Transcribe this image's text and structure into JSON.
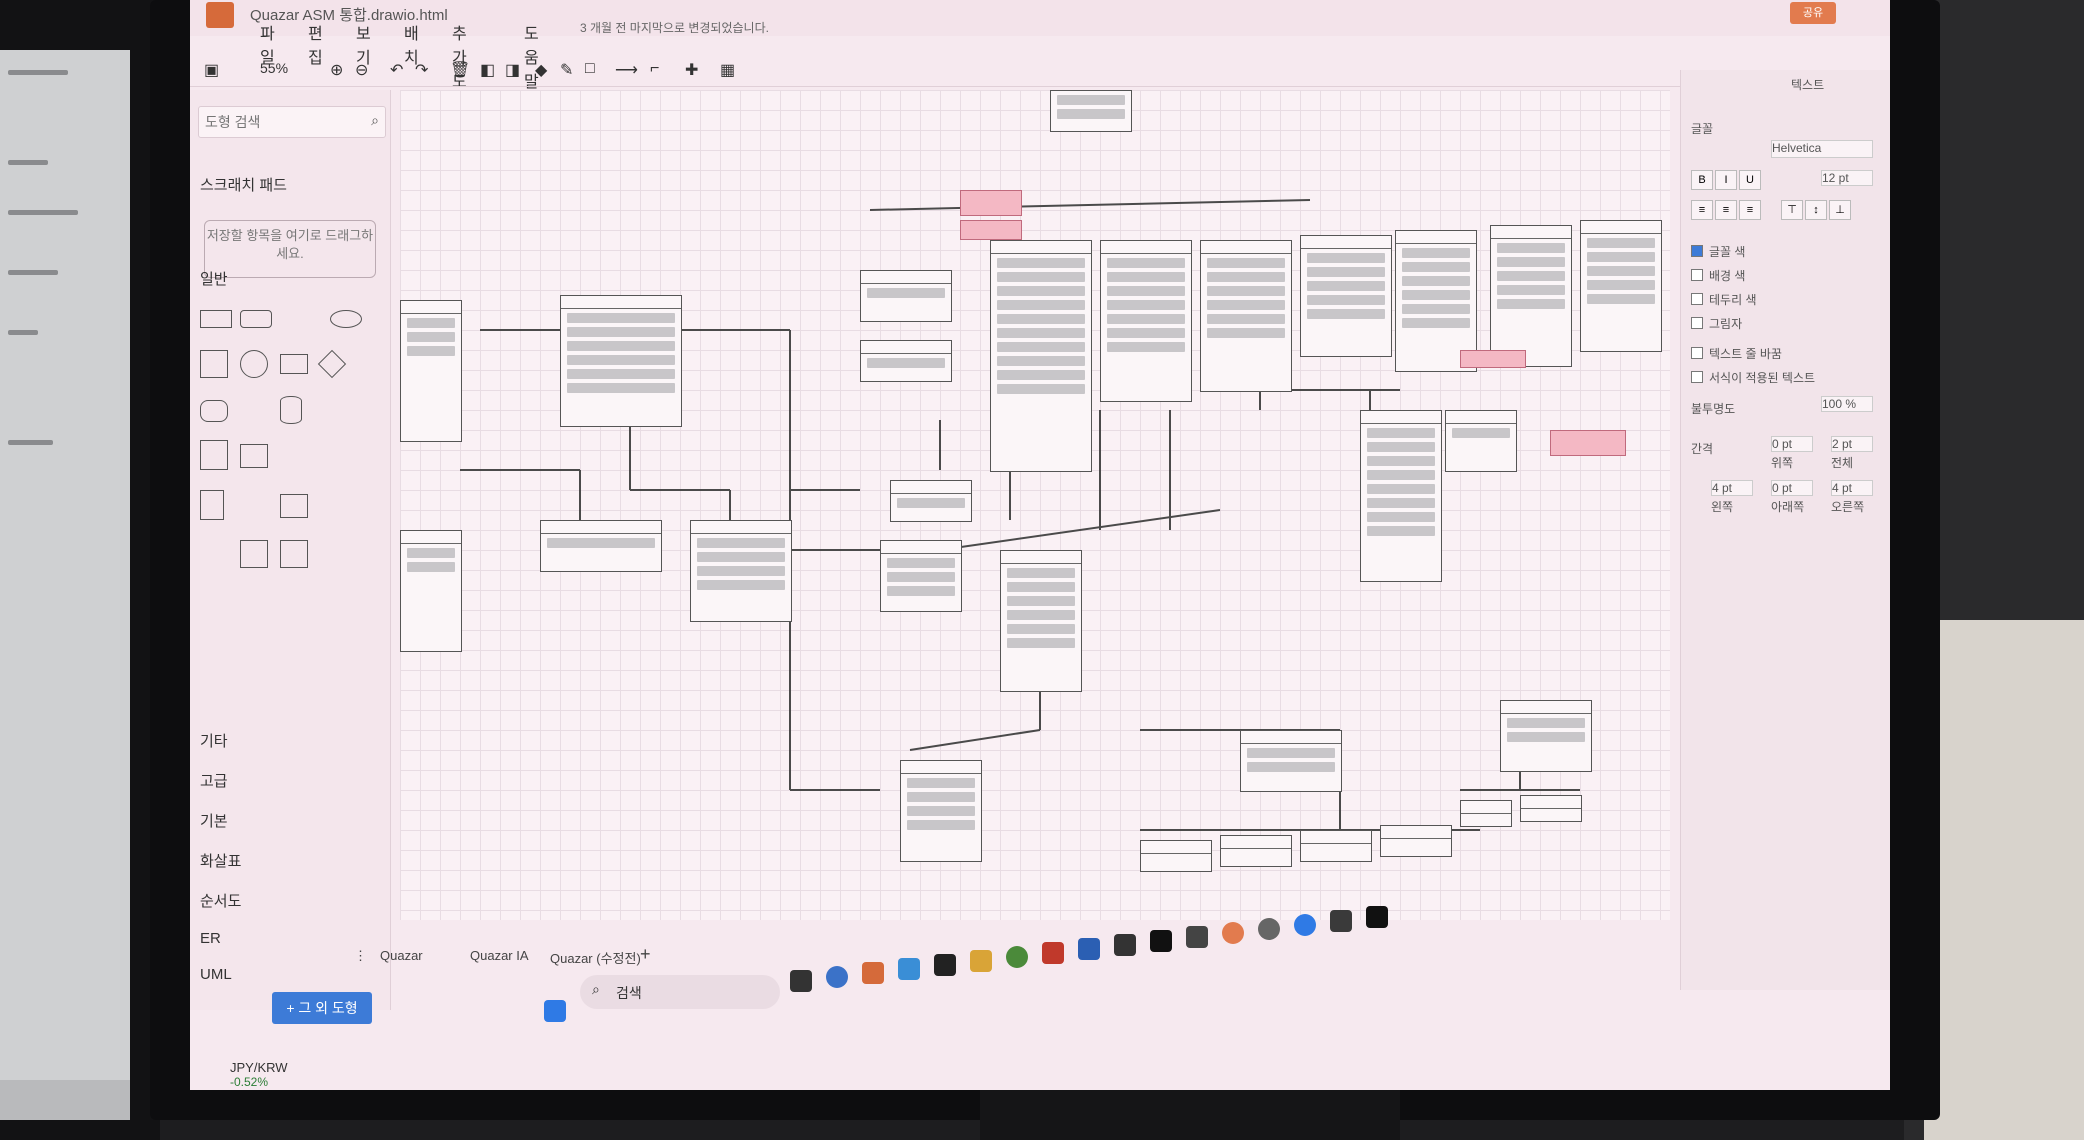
{
  "app": {
    "title": "Quazar ASM 통합.drawio.html",
    "status_message": "3 개월 전 마지막으로 변경되었습니다.",
    "share_label": "공유"
  },
  "menu": [
    "파일",
    "편집",
    "보기",
    "배치",
    "추가 도구",
    "도움말"
  ],
  "toolbar": {
    "zoom": "55%"
  },
  "left_panel": {
    "search_placeholder": "도형 검색",
    "scratchpad_title": "스크래치 패드",
    "scratchpad_hint": "저장할 항목을 여기로 드래그하세요.",
    "general_title": "일반",
    "sections": [
      "기타",
      "고급",
      "기본",
      "화살표",
      "순서도",
      "ER",
      "UML"
    ],
    "more_shapes_label": "+ 그 외 도형"
  },
  "right_panel": {
    "tab_text": "텍스트",
    "font_label": "글꼴",
    "font_value": "Helvetica",
    "font_size": "12 pt",
    "options": [
      "글꼴 색",
      "배경 색",
      "테두리 색",
      "그림자",
      "텍스트 줄 바꿈",
      "서식이 적용된 텍스트"
    ],
    "opacity_label": "불투명도",
    "opacity_value": "100 %",
    "spacing_label": "간격",
    "spacing_fields": [
      {
        "value": "0 pt",
        "label": "위쪽"
      },
      {
        "value": "2 pt",
        "label": "전체"
      },
      {
        "value": "4 pt",
        "label": "왼쪽"
      },
      {
        "value": "0 pt",
        "label": "아래쪽"
      },
      {
        "value": "4 pt",
        "label": "오른쪽"
      }
    ]
  },
  "page_tabs": [
    "Quazar",
    "Quazar IA",
    "Quazar (수정전)"
  ],
  "taskbar": {
    "search_label": "검색"
  },
  "stock": {
    "name": "JPY/KRW",
    "change": "-0.52%"
  },
  "colors": {
    "screen_bg": "#f6e9ef",
    "accent_orange": "#e27b4e",
    "blue_button": "#3d7bd7",
    "note_pink": "#f4b8c4"
  }
}
